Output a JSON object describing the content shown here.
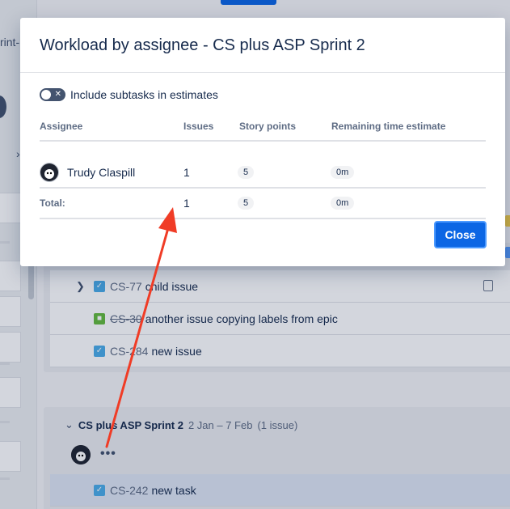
{
  "background": {
    "left_fragment": "rint-",
    "issues": [
      {
        "key": "CS-77",
        "summary": "child issue",
        "type": "task-icon",
        "strike": false,
        "expandable": true
      },
      {
        "key": "CS-30",
        "summary": "another issue copying labels from epic",
        "type": "story-icon",
        "strike": true,
        "expandable": false
      },
      {
        "key": "CS-284",
        "summary": "new issue",
        "type": "task-icon",
        "strike": false,
        "expandable": false
      }
    ],
    "sprint2": {
      "name": "CS plus ASP Sprint 2",
      "dates": "2 Jan – 7 Feb",
      "count": "(1 issue)",
      "more": "•••",
      "issue": {
        "key": "CS-242",
        "summary": "new task"
      }
    }
  },
  "modal": {
    "title": "Workload by assignee - CS plus ASP Sprint 2",
    "toggle_label": "Include subtasks in estimates",
    "columns": [
      "Assignee",
      "Issues",
      "Story points",
      "Remaining time estimate"
    ],
    "rows": [
      {
        "assignee": "Trudy Claspill",
        "issues": "1",
        "story_points": "5",
        "remaining": "0m"
      }
    ],
    "total": {
      "label": "Total:",
      "issues": "1",
      "story_points": "5",
      "remaining": "0m"
    },
    "close_label": "Close"
  },
  "colors": {
    "primary": "#0c66e4",
    "arrow": "#f03c26"
  }
}
